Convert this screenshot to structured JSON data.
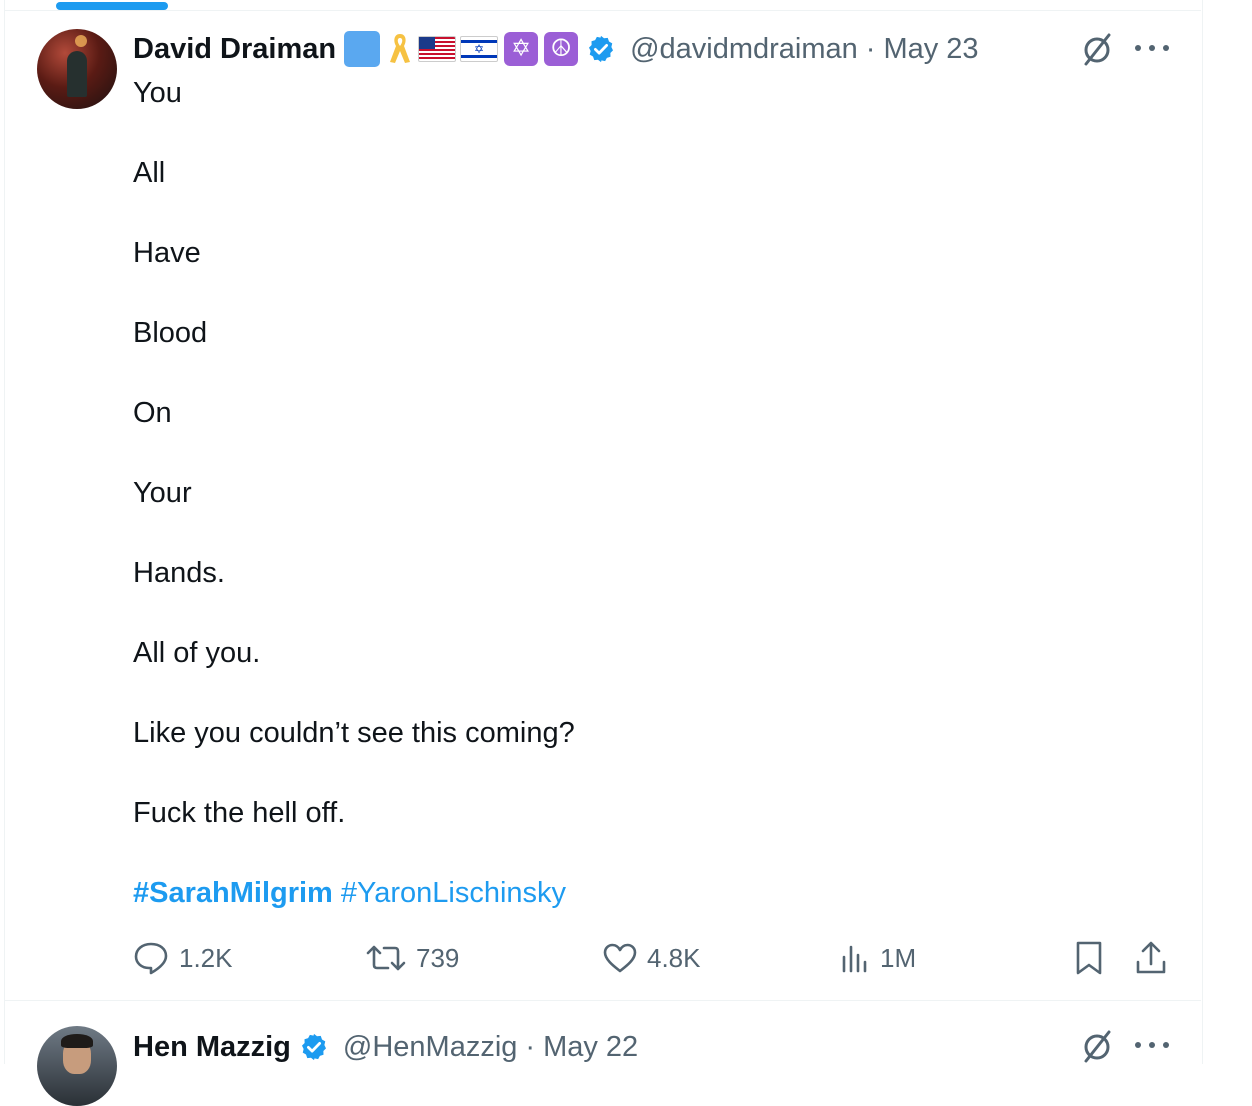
{
  "tweet1": {
    "display_name": "David Draiman",
    "handle": "@davidmdraiman",
    "separator": "·",
    "date": "May 23",
    "badge_emojis": [
      "blue-square",
      "yellow-ribbon",
      "us-flag",
      "israel-flag",
      "star-of-david",
      "peace-symbol"
    ],
    "lines": [
      "You",
      "All",
      "Have",
      "Blood",
      "On",
      "Your",
      "Hands.",
      "All of you.",
      "Like you couldn’t see this coming?",
      "Fuck the hell off."
    ],
    "hashtags": [
      "#SarahMilgrim",
      "#YaronLischinsky"
    ],
    "stats": {
      "replies": "1.2K",
      "retweets": "739",
      "likes": "4.8K",
      "views": "1M"
    }
  },
  "tweet2": {
    "display_name": "Hen Mazzig",
    "handle": "@HenMazzig",
    "separator": "·",
    "date": "May 22"
  },
  "colors": {
    "accent": "#1d9bf0",
    "secondary_text": "#536471",
    "primary_text": "#0f1419"
  }
}
